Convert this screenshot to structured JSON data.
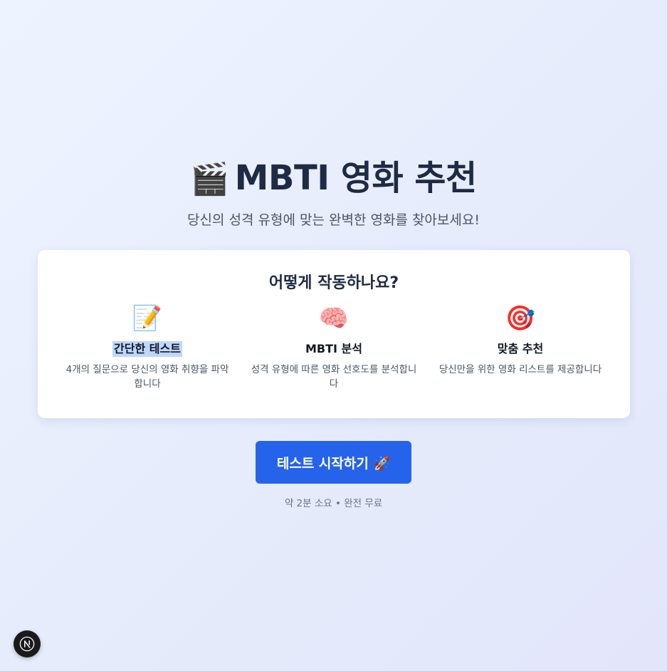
{
  "hero": {
    "title_icon": "🎬",
    "title": "MBTI 영화 추천",
    "subtitle": "당신의 성격 유형에 맞는 완벽한 영화를 찾아보세요!"
  },
  "how": {
    "title": "어떻게 작동하나요?",
    "features": [
      {
        "icon": "📝",
        "icon_name": "memo-icon",
        "name": "간단한 테스트",
        "desc": "4개의 질문으로 당신의 영화 취향을 파악합니다"
      },
      {
        "icon": "🧠",
        "icon_name": "brain-icon",
        "name": "MBTI 분석",
        "desc": "성격 유형에 따른 영화 선호도를 분석합니다"
      },
      {
        "icon": "🎯",
        "icon_name": "target-icon",
        "name": "맞춤 추천",
        "desc": "당신만을 위한 영화 리스트를 제공합니다"
      }
    ]
  },
  "cta": {
    "label": "테스트 시작하기 🚀"
  },
  "note": "약 2분 소요 • 완전 무료",
  "badge": {
    "letter": "N",
    "icon_name": "next-logo-icon"
  },
  "colors": {
    "accent": "#2563eb",
    "title": "#1f2a44"
  }
}
